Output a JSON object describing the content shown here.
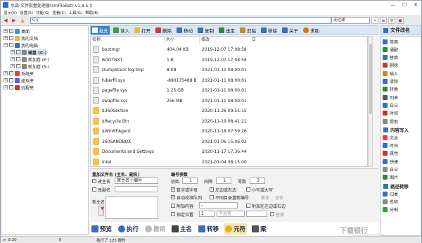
{
  "app": {
    "title": "水淼·文件批量处理器(smFileBat) v1.8.5.0"
  },
  "menu": [
    "显示(X)",
    "设置(S)",
    "功能(G)",
    "查看(C)",
    "工具(G)",
    "帮助(B)"
  ],
  "path": {
    "value": "C:\\",
    "filter": "无过滤"
  },
  "tree": [
    {
      "label": "桌面",
      "level": 0
    },
    {
      "label": "我的文档",
      "level": 0
    },
    {
      "label": "我的电脑",
      "level": 0
    },
    {
      "label": "硬盘 (C:)",
      "level": 1
    },
    {
      "label": "新加卷 (F:)",
      "level": 1
    },
    {
      "label": "新加卷 (S:)",
      "level": 1
    },
    {
      "label": "系统夹",
      "level": 0
    },
    {
      "label": "虚拟夹",
      "level": 0
    },
    {
      "label": "远程夹",
      "level": 0
    }
  ],
  "toolbar": [
    "批处",
    "读入",
    "打开",
    "删除",
    "移动",
    "复制",
    "选定",
    "剪贴",
    "移除",
    "关于",
    "求助"
  ],
  "filelist": {
    "headers": [
      "名称",
      "大小",
      "修改",
      "日"
    ],
    "rows": [
      {
        "name": "bootmgr",
        "size": "404.04 KB",
        "date": "2019-12-07 17:08:58",
        "folder": false
      },
      {
        "name": "BOOTNXT",
        "size": "1 B",
        "date": "2019-12-07 17:08:58",
        "folder": false
      },
      {
        "name": "DumpStack.log.tmp",
        "size": "8 KB",
        "date": "2021-01-11 08:00:01",
        "folder": false
      },
      {
        "name": "hiberfil.sys",
        "size": "-890175488 B",
        "date": "2021-01-11 08:00:01",
        "folder": false
      },
      {
        "name": "pagefile.sys",
        "size": "1.25 GB",
        "date": "2021-01-11 08:00:01",
        "folder": false
      },
      {
        "name": "swapfile.sys",
        "size": "256 MB",
        "date": "2021-01-11 08:00:01",
        "folder": false
      },
      {
        "name": "$360Section",
        "size": "",
        "date": "2020-11-26 09:51:15",
        "folder": true
      },
      {
        "name": "$Recycle.Bin",
        "size": "",
        "date": "2020-11-19 08:41:21",
        "folder": true
      },
      {
        "name": "$WinREAgent",
        "size": "",
        "date": "2020-11-18 07:59:26",
        "folder": true
      },
      {
        "name": "360SANDBOX",
        "size": "",
        "date": "2021-01-06 15:06:02",
        "folder": true
      },
      {
        "name": "Documents and Settings",
        "size": "",
        "date": "2020-11-17 17:36:44",
        "folder": true
      },
      {
        "name": "Intel",
        "size": "",
        "date": "2021-01-04 08:15:00",
        "folder": true
      }
    ]
  },
  "panel": {
    "rename_title": "重加文件名 (主名、副名)",
    "main_name_label": "改主名",
    "main_name_value": "原主名＋编号",
    "ext_label": "改副名",
    "new_main_label": "新主名",
    "num_title": "编号参数",
    "start_label": "初始",
    "start_value": "1",
    "step_label": "间隔",
    "step_value": "1",
    "digits_label": "零数",
    "digits_value": "3",
    "opt1": "数字或字母",
    "opt2": "左边或右边",
    "opt3": "小写或大写",
    "opt4": "自动校准队列",
    "opt5": "不同目录重新编号",
    "opt5b": "繁体",
    "opt5c": "全体",
    "append_label": "附加内容",
    "append_value": "-",
    "append_edge": "附加在左边或右边",
    "pos_label": "指定位置",
    "pos_value": "1",
    "pos_sel": "不适置",
    "replace": "替换"
  },
  "bigbar": [
    "预览",
    "执行",
    "撤销",
    "主名",
    "转移",
    "元符",
    "案"
  ],
  "side": {
    "title": "文件改名",
    "group1": [
      "常用",
      "通配",
      "替换",
      "删除",
      "插入",
      "清除",
      "转换",
      "列表",
      "自日",
      "时间",
      "提取"
    ],
    "group2_title": "内容写入",
    "group2": [
      "文本",
      "时间",
      "属性",
      "快捷",
      "自日",
      "图片"
    ],
    "group3_title": "路径转移",
    "group3": [
      "归类",
      "名称",
      "分割"
    ]
  },
  "status": {
    "left": "0:20",
    "count": "0",
    "exec": "执行了 125 数秒"
  },
  "watermark": {
    "main": "下载银行",
    "sub": "www.downbank.cn"
  }
}
